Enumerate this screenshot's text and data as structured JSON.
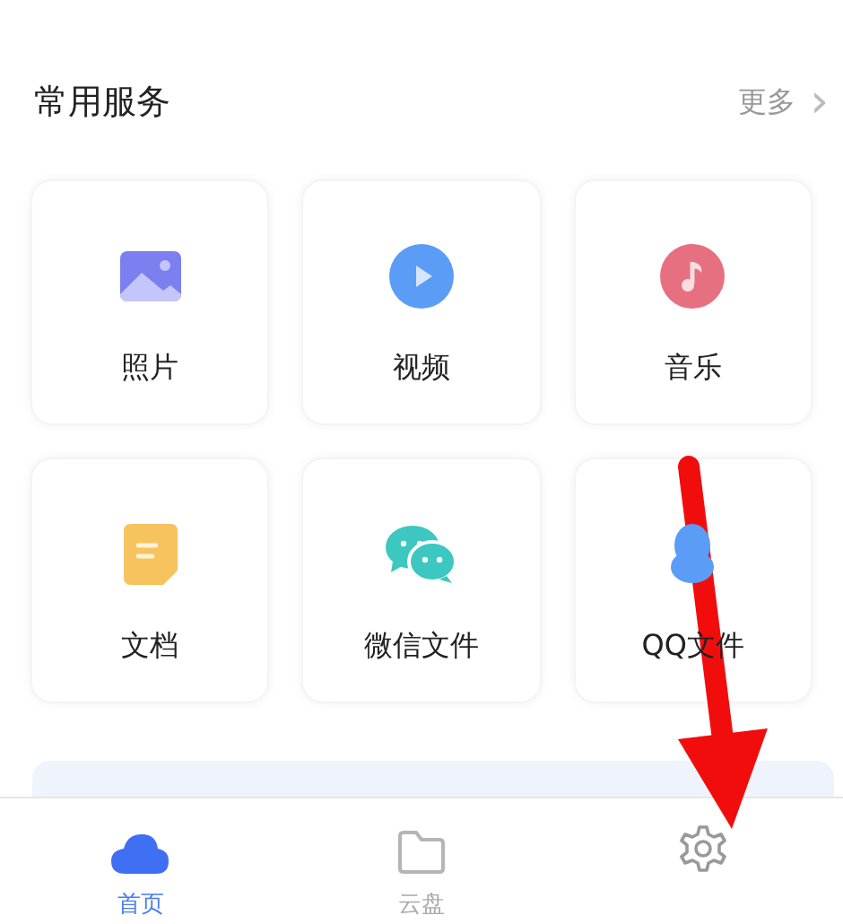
{
  "section": {
    "title": "常用服务",
    "more": "更多",
    "more_chevron": "›"
  },
  "services": [
    {
      "kind": "photo",
      "label": "照片"
    },
    {
      "kind": "video",
      "label": "视频"
    },
    {
      "kind": "music",
      "label": "音乐"
    },
    {
      "kind": "doc",
      "label": "文档"
    },
    {
      "kind": "wechat",
      "label": "微信文件"
    },
    {
      "kind": "qq",
      "label": "QQ文件"
    }
  ],
  "tabs": [
    {
      "kind": "cloud",
      "label": "首页",
      "selected": true
    },
    {
      "kind": "folder",
      "label": "云盘",
      "selected": false
    },
    {
      "kind": "gear",
      "selected": false
    }
  ]
}
